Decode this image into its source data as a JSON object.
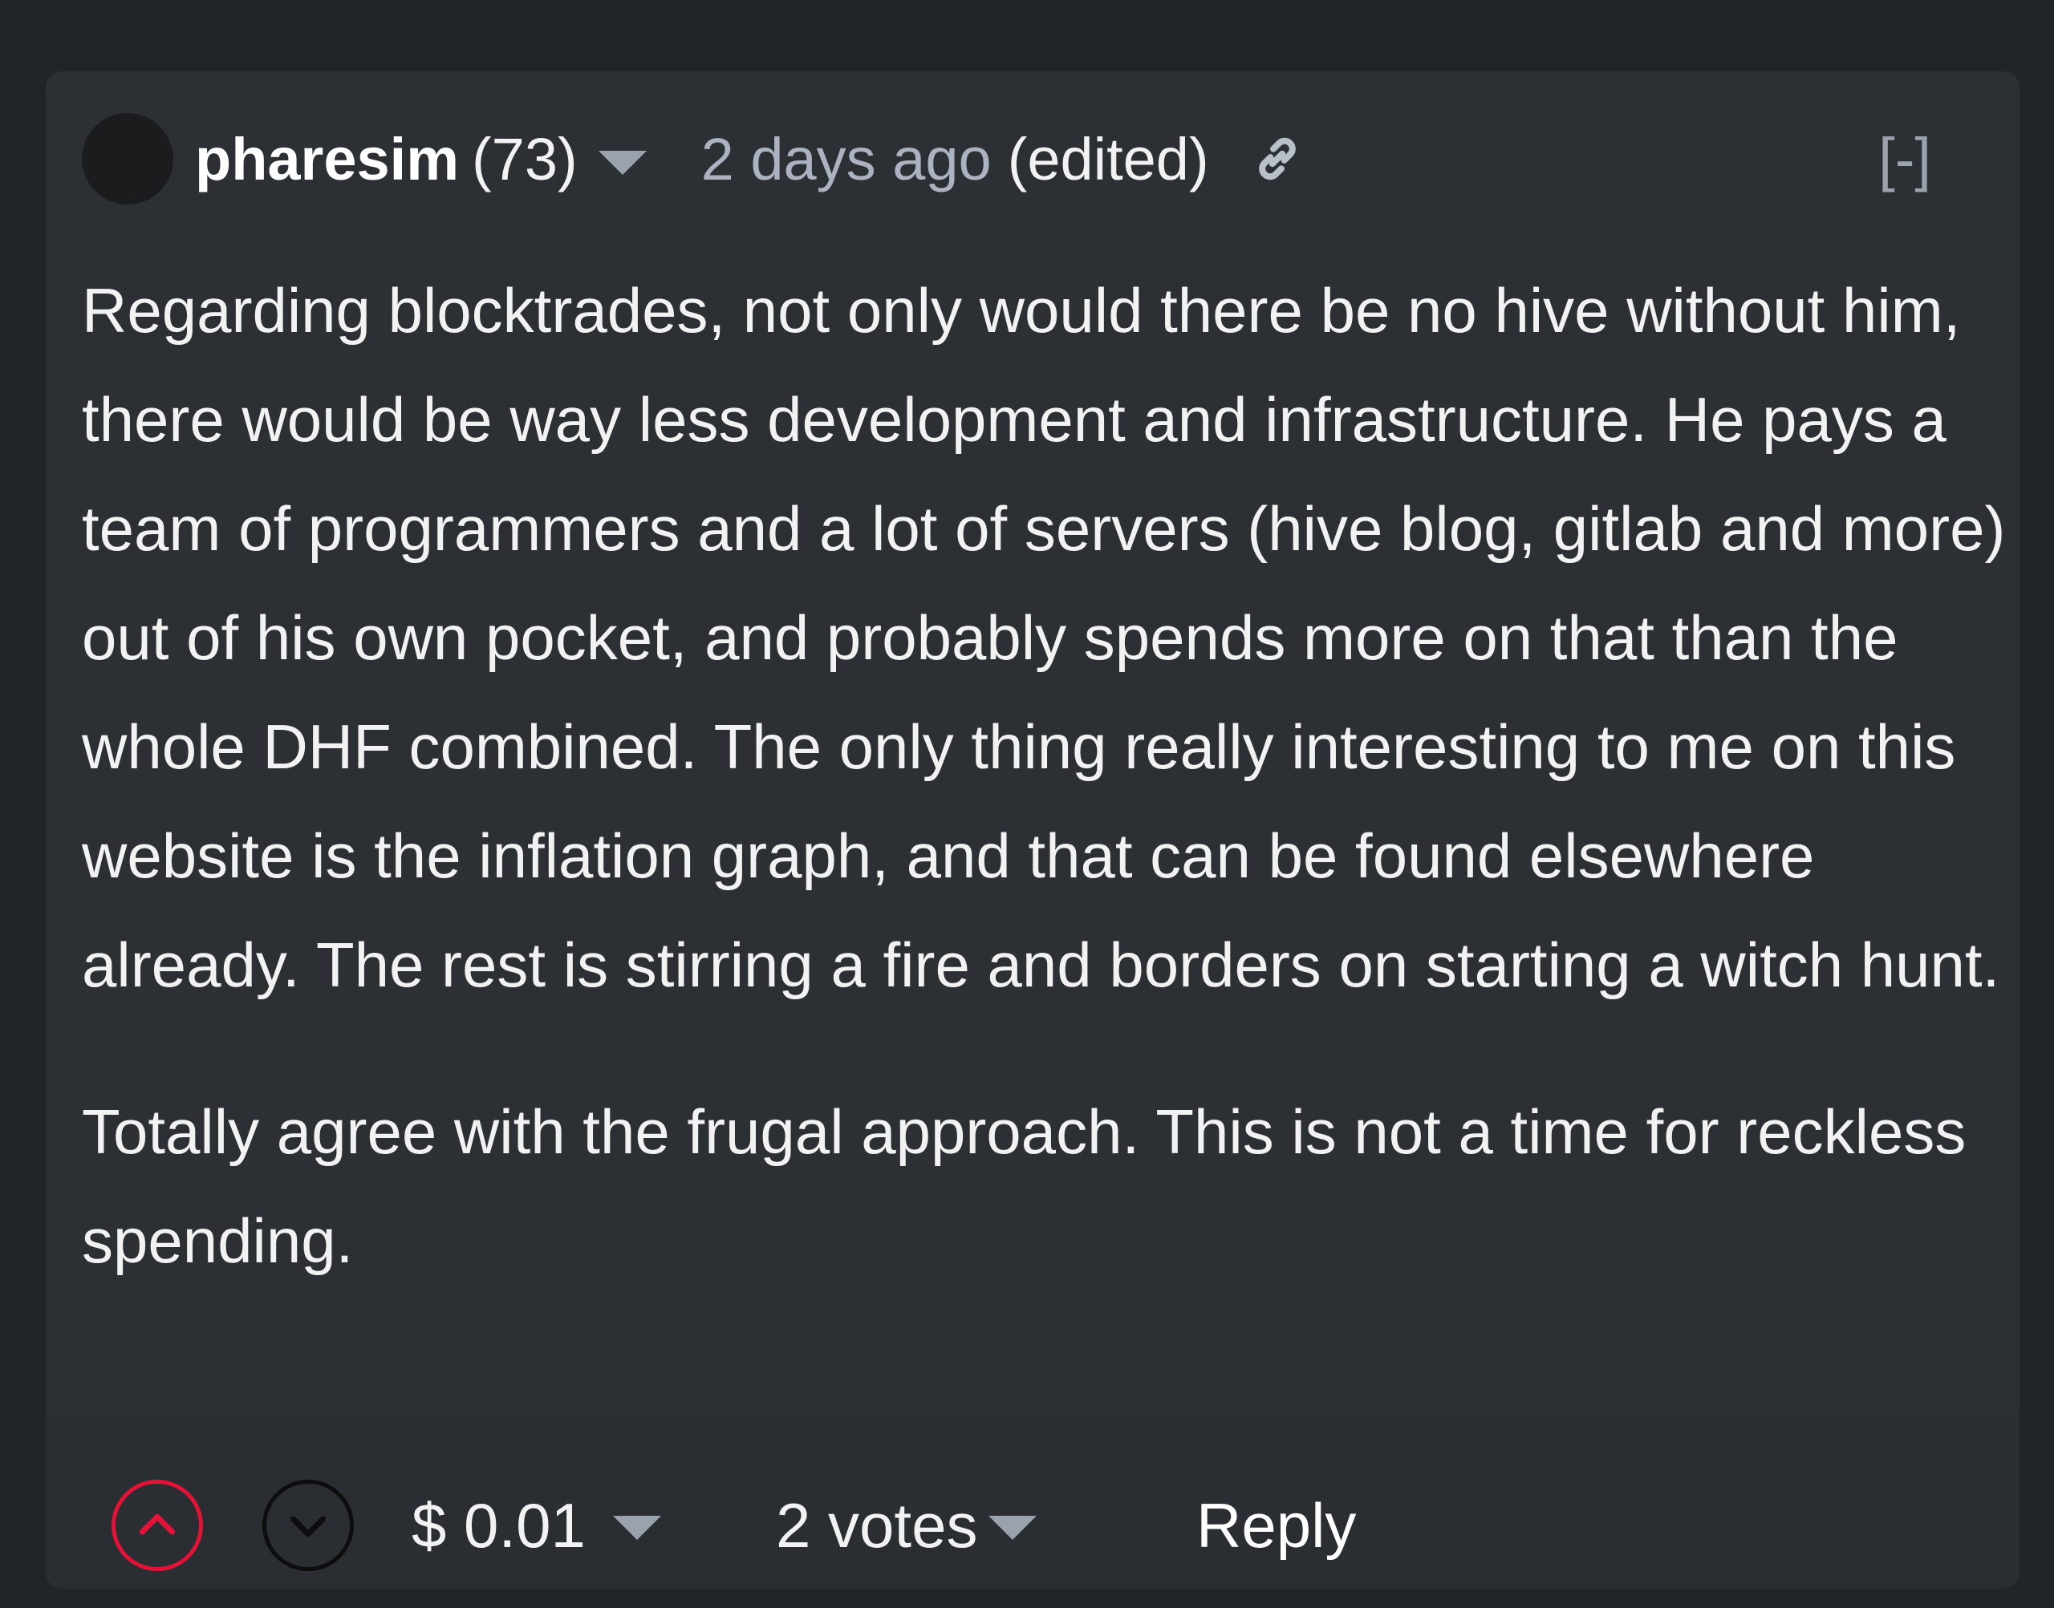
{
  "comment": {
    "author": "pharesim",
    "reputation": "(73)",
    "timestamp": "2 days ago",
    "edited_label": "(edited)",
    "collapse_label": "[-]",
    "paragraphs": [
      "Regarding blocktrades, not only would there be no hive without him, there would be way less development and infrastructure. He pays a team of programmers and a lot of servers (hive blog, gitlab and more) out of his own pocket, and probably spends more on that than the whole DHF combined. The only thing really interesting to me on this website is the inflation graph, and that can be found elsewhere already. The rest is stirring a fire and borders on starting a witch hunt.",
      "Totally agree with the frugal approach. This is not a time for reckless spending."
    ]
  },
  "footer": {
    "payout": "$ 0.01",
    "votes": "2 votes",
    "reply_label": "Reply"
  },
  "icons": {
    "avatar": "avatar",
    "author_menu": "chevron-down-icon",
    "permalink": "link-icon",
    "upvote": "upvote-icon",
    "downvote": "downvote-icon"
  },
  "colors": {
    "page_background": "#212429",
    "card_background": "#2c3035",
    "upvote_accent": "#e31337",
    "muted_text": "#aab3bf"
  }
}
